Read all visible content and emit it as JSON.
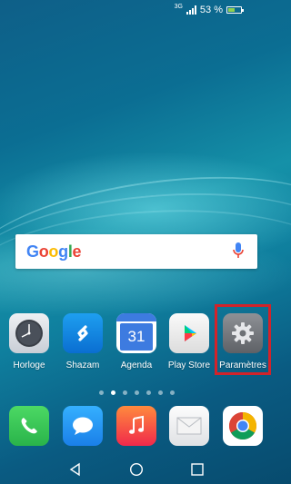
{
  "status_bar": {
    "network": "3G",
    "battery_text": "53 %",
    "battery_level": 0.53,
    "battery_color": "#8fd14f"
  },
  "search_bar": {
    "logo_letters": [
      {
        "char": "G",
        "color": "#4285f4"
      },
      {
        "char": "o",
        "color": "#ea4335"
      },
      {
        "char": "o",
        "color": "#fbbc05"
      },
      {
        "char": "g",
        "color": "#4285f4"
      },
      {
        "char": "l",
        "color": "#34a853"
      },
      {
        "char": "e",
        "color": "#ea4335"
      }
    ],
    "mic_icon": "microphone-icon"
  },
  "apps_row": [
    {
      "label": "Horloge",
      "icon": "clock-icon"
    },
    {
      "label": "Shazam",
      "icon": "shazam-icon"
    },
    {
      "label": "Agenda",
      "icon": "calendar-icon",
      "day": "31"
    },
    {
      "label": "Play Store",
      "icon": "play-store-icon"
    },
    {
      "label": "Paramètres",
      "icon": "gear-icon"
    }
  ],
  "highlight_color": "#d2232a",
  "page_indicator": {
    "count": 7,
    "active_index": 1
  },
  "dock": [
    {
      "icon": "phone-icon"
    },
    {
      "icon": "messages-icon"
    },
    {
      "icon": "music-icon"
    },
    {
      "icon": "email-icon"
    },
    {
      "icon": "chrome-icon"
    }
  ],
  "nav_bar": {
    "back": "back-icon",
    "home": "home-icon",
    "recents": "recents-icon"
  }
}
